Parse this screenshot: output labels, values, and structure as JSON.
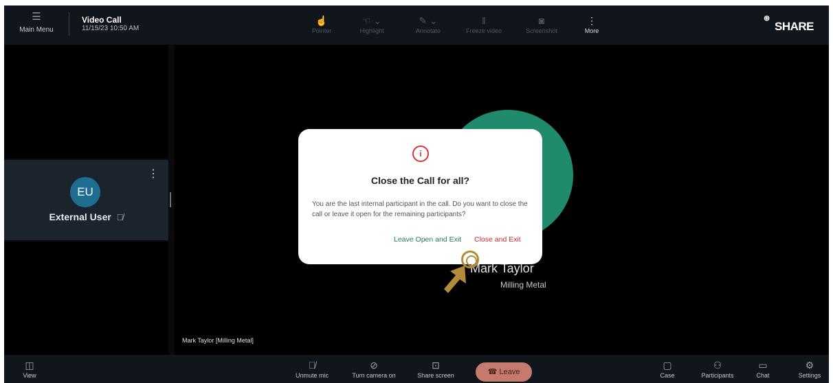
{
  "header": {
    "menu_label": "Main Menu",
    "call_title": "Video Call",
    "call_datetime": "11/15/23  10:50 AM",
    "tools": [
      {
        "label": "Pointer",
        "icon": "pointer-icon"
      },
      {
        "label": "Highlight",
        "icon": "highlight-icon"
      },
      {
        "label": "Annotate",
        "icon": "annotate-icon"
      },
      {
        "label": "Freeze video",
        "icon": "pause-icon"
      },
      {
        "label": "Screenshot",
        "icon": "camera-icon"
      },
      {
        "label": "More",
        "icon": "more-vertical-icon"
      }
    ],
    "logo_text": "SHARE"
  },
  "participants": {
    "external_user": {
      "initials": "EU",
      "name": "External User",
      "mic_muted": true
    }
  },
  "main_stage": {
    "presenter_name": "Mark Taylor",
    "presenter_company": "Milling Metal",
    "caption": "Mark Taylor [Milling Metal]",
    "avatar_color": "#1f8a6c"
  },
  "dialog": {
    "title": "Close the Call for all?",
    "body": "You are the last internal participant in the call. Do you want to close the call or leave it open for the remaining participants?",
    "leave_open_label": "Leave Open and Exit",
    "close_label": "Close and Exit",
    "accent_color": "#d1262f"
  },
  "footer": {
    "view_label": "View",
    "unmute_label": "Unmute mic",
    "camera_label": "Turn camera on",
    "share_label": "Share screen",
    "leave_label": "Leave",
    "case_label": "Case",
    "participants_label": "Participants",
    "chat_label": "Chat",
    "settings_label": "Settings"
  }
}
